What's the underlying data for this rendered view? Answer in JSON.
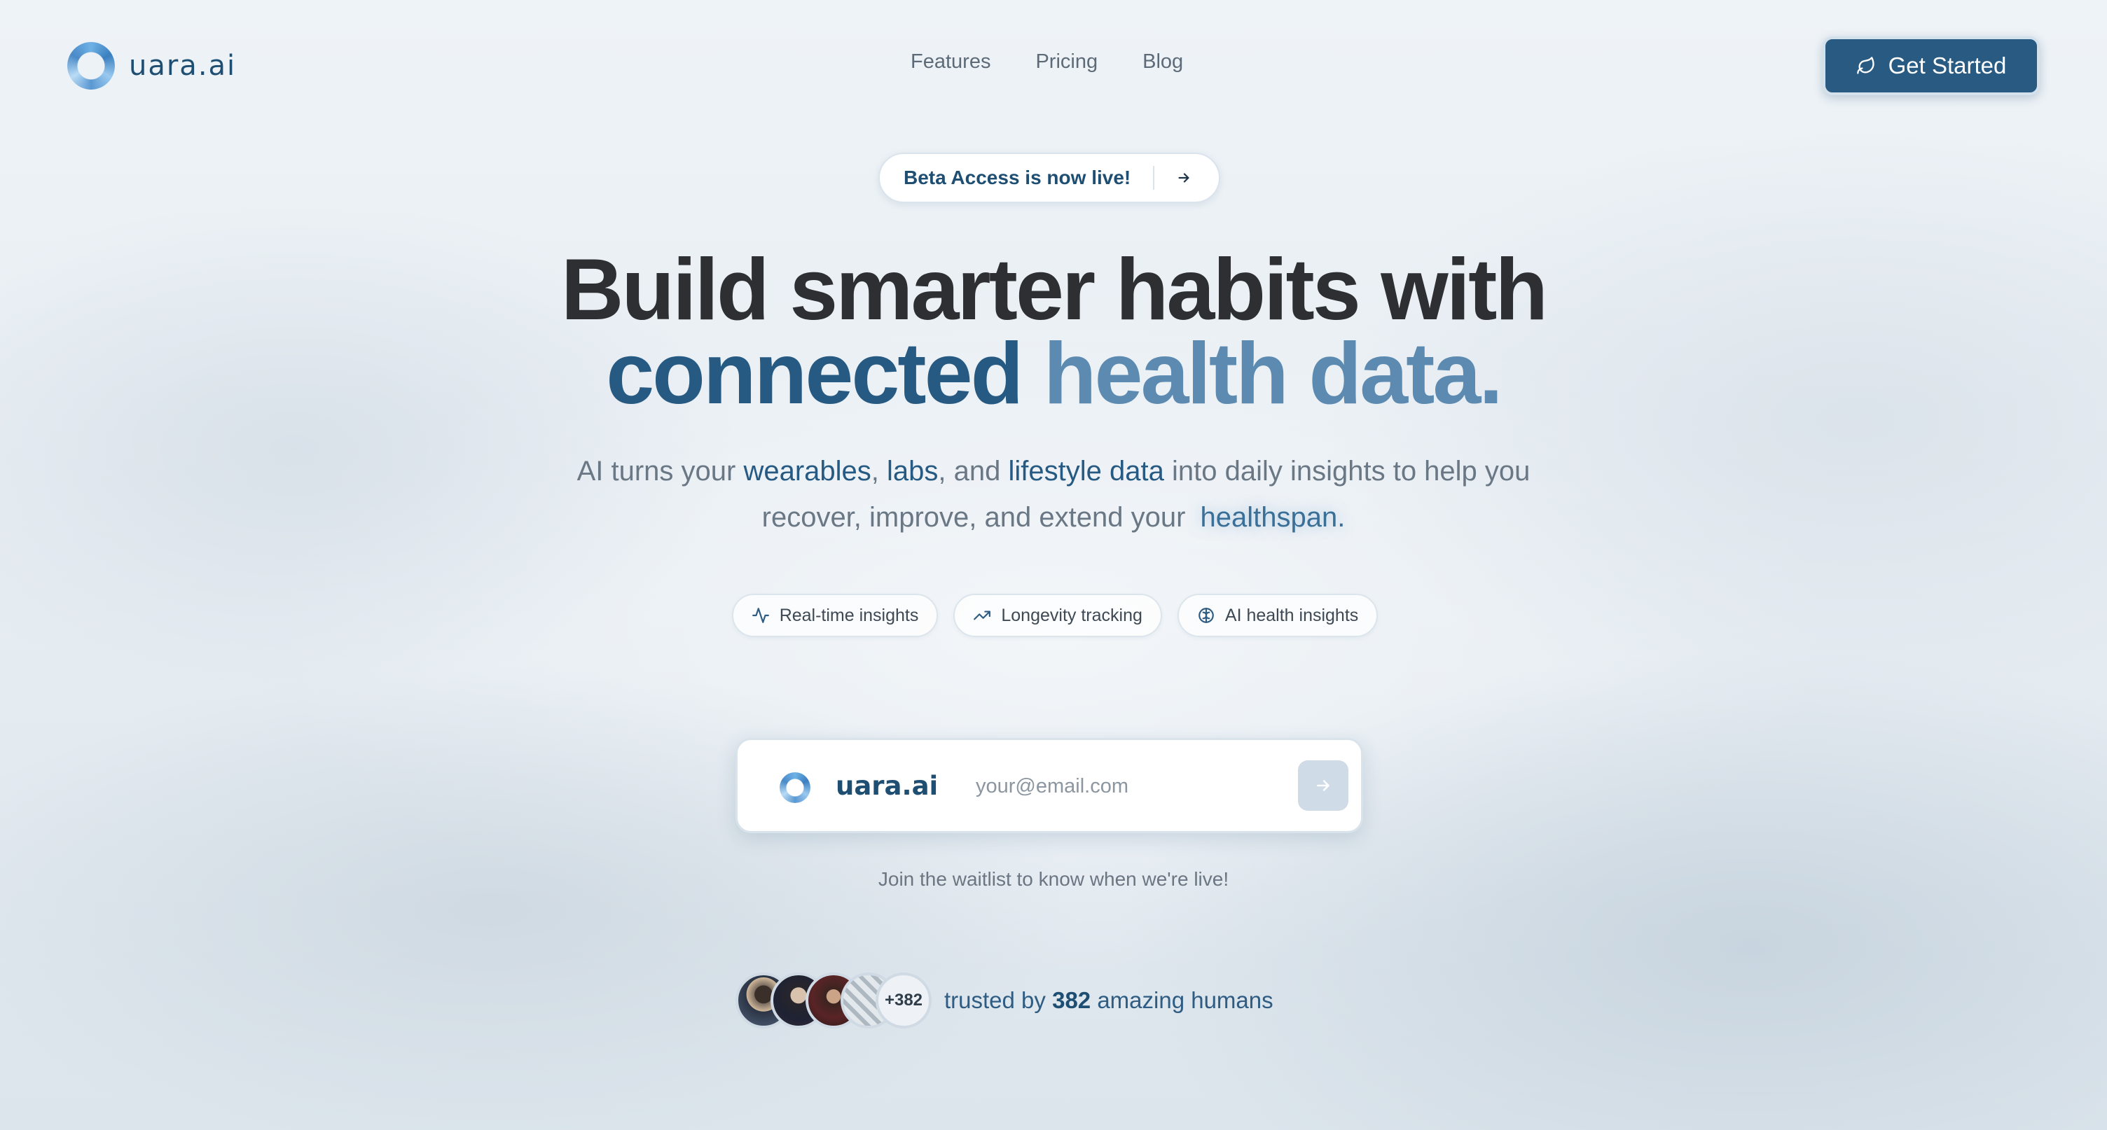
{
  "nav": {
    "brand": "uara.ai",
    "links": [
      "Features",
      "Pricing",
      "Blog"
    ],
    "cta_label": "Get Started"
  },
  "beta": {
    "label": "Beta Access is now live!"
  },
  "hero": {
    "line1": "Build smarter habits with",
    "line2_a": "connected",
    "line2_b": "health data."
  },
  "subtitle": {
    "p1": "AI turns your",
    "k1": "wearables",
    "p2": ",",
    "k2": "labs",
    "p3": ", and",
    "k3": "lifestyle data",
    "p4": "into daily insights to help you",
    "p5": "recover, improve, and extend your",
    "k4": "healthspan."
  },
  "chips": [
    {
      "icon": "activity-icon",
      "label": "Real-time insights"
    },
    {
      "icon": "trending-up-icon",
      "label": "Longevity tracking"
    },
    {
      "icon": "brain-icon",
      "label": "AI health insights"
    }
  ],
  "form": {
    "brand": "uara.ai",
    "placeholder": "your@email.com",
    "hint": "Join the waitlist to know when we're live!"
  },
  "trusted": {
    "more_badge": "+382",
    "prefix": "trusted by",
    "count": "382",
    "suffix": "amazing humans"
  },
  "colors": {
    "brand_dark": "#295a82",
    "brand_light": "#5c8ab0",
    "headline": "#2d2f33"
  }
}
